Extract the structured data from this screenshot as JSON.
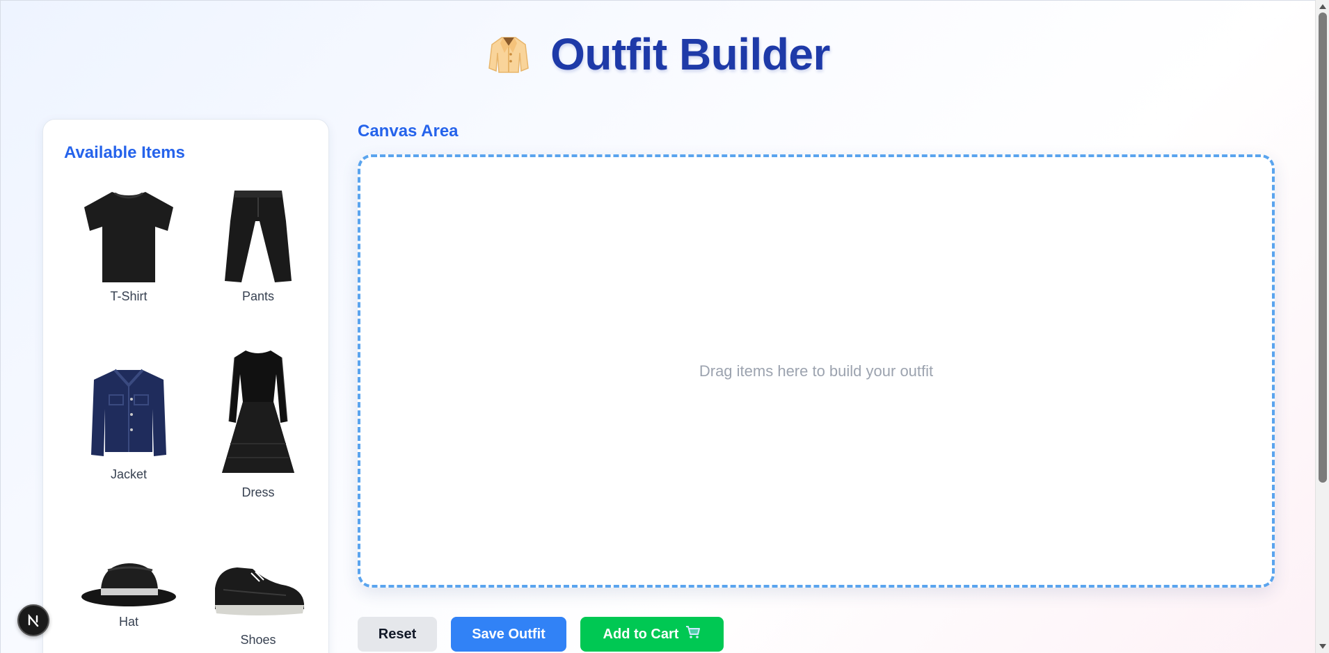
{
  "header": {
    "title": "Outfit Builder",
    "icon": "coat-icon"
  },
  "sidebar": {
    "title": "Available Items",
    "items": [
      {
        "label": "T-Shirt",
        "icon": "tshirt-icon"
      },
      {
        "label": "Pants",
        "icon": "pants-icon"
      },
      {
        "label": "Jacket",
        "icon": "jacket-icon"
      },
      {
        "label": "Dress",
        "icon": "dress-icon"
      },
      {
        "label": "Hat",
        "icon": "hat-icon"
      },
      {
        "label": "Shoes",
        "icon": "shoe-icon"
      }
    ]
  },
  "canvas": {
    "label": "Canvas Area",
    "placeholder": "Drag items here to build your outfit"
  },
  "actions": {
    "reset_label": "Reset",
    "save_label": "Save Outfit",
    "cart_label": "Add to Cart",
    "cart_icon": "shopping-cart-icon"
  },
  "colors": {
    "title": "#1e3aa8",
    "accent": "#2563eb",
    "canvas_border": "#5aa4ee",
    "save_button": "#3182f6",
    "cart_button": "#00c853",
    "reset_button": "#e5e7eb"
  }
}
